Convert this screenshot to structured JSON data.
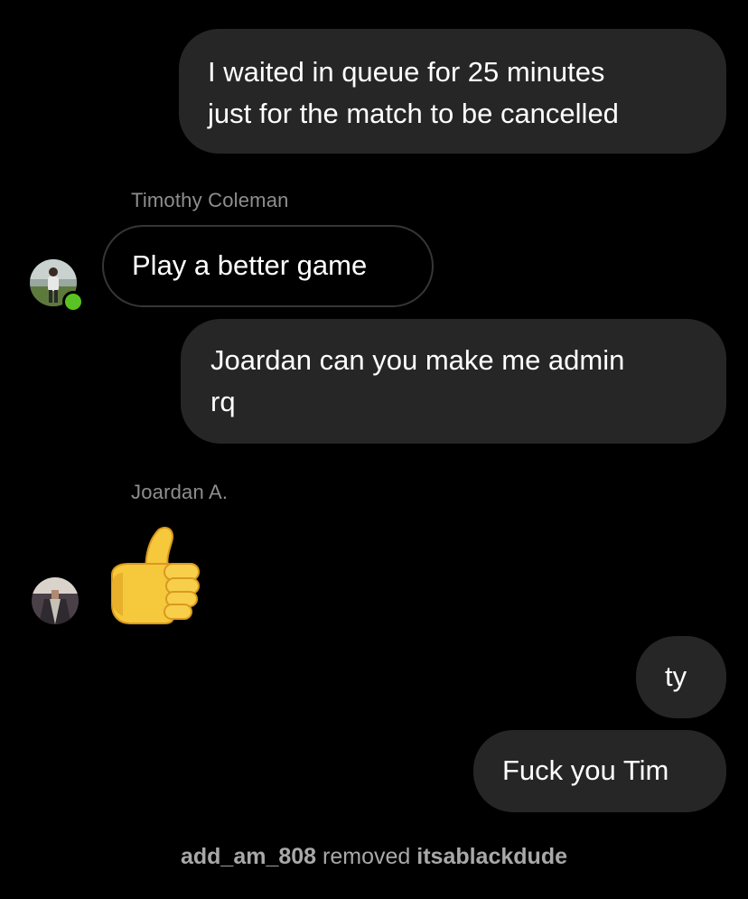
{
  "messages": [
    {
      "kind": "outgoing",
      "text_line1": "I waited in queue for 25 minutes",
      "text_line2": "just for the match to be cancelled"
    },
    {
      "kind": "incoming",
      "sender": "Timothy Coleman",
      "text": "Play a better game"
    },
    {
      "kind": "outgoing",
      "text_line1": "Joardan can you make me admin",
      "text_line2": "rq"
    },
    {
      "kind": "incoming",
      "sender": "Joardan A.",
      "emoji": "👍"
    },
    {
      "kind": "outgoing",
      "text": "ty"
    },
    {
      "kind": "outgoing",
      "text": "Fuck you Tim"
    }
  ],
  "system_event": {
    "actor": "add_am_808",
    "action": "removed",
    "target": "itsablackdude"
  },
  "colors": {
    "background": "#000000",
    "outgoing_bubble": "#262626",
    "incoming_border": "#363636",
    "sender_name": "#8e8e8e",
    "online": "#58c322"
  }
}
